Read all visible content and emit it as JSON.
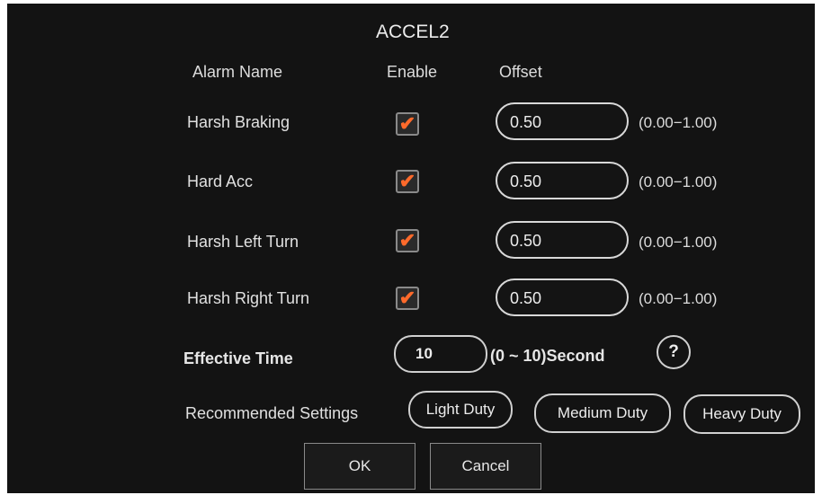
{
  "dialog": {
    "title": "ACCEL2",
    "headers": {
      "alarm_name": "Alarm Name",
      "enable": "Enable",
      "offset": "Offset"
    },
    "alarms": [
      {
        "name": "Harsh Braking",
        "enabled": true,
        "offset": "0.50",
        "range": "(0.00−1.00)"
      },
      {
        "name": "Hard Acc",
        "enabled": true,
        "offset": "0.50",
        "range": "(0.00−1.00)"
      },
      {
        "name": "Harsh Left Turn",
        "enabled": true,
        "offset": "0.50",
        "range": "(0.00−1.00)"
      },
      {
        "name": "Harsh Right Turn",
        "enabled": true,
        "offset": "0.50",
        "range": "(0.00−1.00)"
      }
    ],
    "effective_time": {
      "label": "Effective Time",
      "value": "10",
      "unit": "(0 ~ 10)Second",
      "help_glyph": "?"
    },
    "recommended": {
      "label": "Recommended Settings",
      "light": "Light Duty",
      "medium": "Medium Duty",
      "heavy": "Heavy Duty"
    },
    "buttons": {
      "ok": "OK",
      "cancel": "Cancel"
    },
    "check_glyph": "✔",
    "accent_color": "#ff6a2b"
  }
}
